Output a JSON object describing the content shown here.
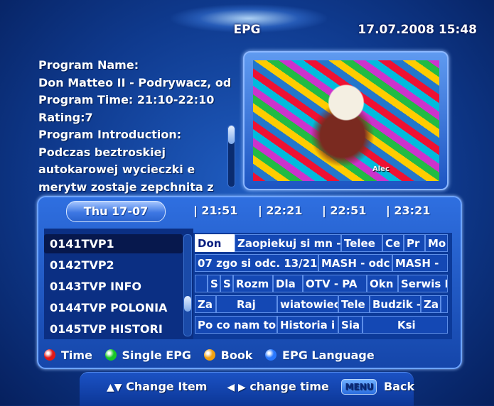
{
  "header": {
    "title": "EPG",
    "datetime": "17.07.2008  15:48"
  },
  "program_info": {
    "lines": [
      "Program Name:",
      "Don Matteo II - Podrywacz, od",
      "Program Time: 21:10-22:10",
      "Rating:7",
      "Program Introduction:",
      "Podczas beztroskiej",
      "autokarowej wycieczki e",
      "merytw zostaje zepchnita z"
    ]
  },
  "preview": {
    "overlay_text": "Alec"
  },
  "timeline": {
    "date_tab": "Thu 17-07",
    "times": [
      "| 21:51",
      "| 22:21",
      "| 22:51",
      "| 23:21"
    ]
  },
  "channels": [
    "0141TVP1",
    "0142TVP2",
    "0143TVP INFO",
    "0144TVP POLONIA",
    "0145TVP HISTORI"
  ],
  "selected_channel_index": 0,
  "grid": [
    [
      "Don",
      "Zaopiekuj si mn -",
      "Telee",
      "Ce",
      "Pr",
      "Mo"
    ],
    [
      "07 zgo si odc. 13/21",
      "MASH - odc",
      "MASH -"
    ],
    [
      "",
      "S",
      "S",
      "Rozm",
      "Dla",
      "OTV - PA",
      "Okn",
      "Serwis I"
    ],
    [
      "Za",
      "Raj",
      "wiatowiec",
      "Tele",
      "Budzik -",
      "Za",
      ""
    ],
    [
      "Po co nam to",
      "Historia i",
      "Sia",
      "Ksi"
    ]
  ],
  "legend": [
    {
      "label": "Time",
      "color": "#e01818"
    },
    {
      "label": "Single EPG",
      "color": "#18c828"
    },
    {
      "label": "Book",
      "color": "#f0a010"
    },
    {
      "label": "EPG Language",
      "color": "#2878ff"
    }
  ],
  "footer": {
    "up_down": "▲▼",
    "change_item": "Change Item",
    "left_right": "◀ ▶",
    "change_time": "change time",
    "menu_key": "MENU",
    "back": "Back"
  }
}
